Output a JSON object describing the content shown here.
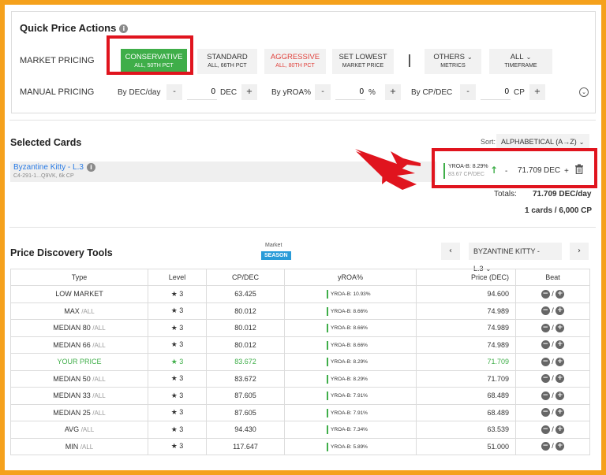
{
  "quick_price": {
    "title": "Quick Price Actions",
    "market_label": "MARKET PRICING",
    "buttons": [
      {
        "label": "CONSERVATIVE",
        "sub": "ALL, 50TH PCT"
      },
      {
        "label": "STANDARD",
        "sub": "ALL, 66TH PCT"
      },
      {
        "label": "AGGRESSIVE",
        "sub": "ALL, 80TH PCT"
      },
      {
        "label": "SET LOWEST",
        "sub": "MARKET PRICE"
      },
      {
        "label": "OTHERS",
        "sub": "METRICS"
      },
      {
        "label": "ALL",
        "sub": "TIMEFRAME"
      }
    ],
    "manual_label": "MANUAL PRICING",
    "manual": [
      {
        "label": "By DEC/day",
        "value": "0",
        "unit": "DEC"
      },
      {
        "label": "By yROA%",
        "value": "0",
        "unit": "%"
      },
      {
        "label": "By CP/DEC",
        "value": "0",
        "unit": "CP"
      }
    ],
    "minus": "-",
    "plus": "+"
  },
  "selected": {
    "title": "Selected Cards",
    "sort_label": "Sort:",
    "sort_value": "ALPHABETICAL (A→Z)",
    "card": {
      "name": "Byzantine Kitty - L.3",
      "sub": "C4-291-1...Q9VK, 6k CP",
      "roa": "YROA-B: 8.29%",
      "cp": "83.67 CP/DEC",
      "price": "71.709",
      "unit": "DEC"
    },
    "totals_label": "Totals:",
    "totals_value": "71.709 DEC/day",
    "count": "1 cards / 6,000 CP"
  },
  "discovery": {
    "title": "Price Discovery Tools",
    "market_caption": "Market",
    "season_badge": "SEASON",
    "card_select": "BYZANTINE KITTY - L.3",
    "prev": "‹",
    "next": "›",
    "headers": [
      "Type",
      "Level",
      "CP/DEC",
      "yROA%",
      "Price (DEC)",
      "Beat"
    ],
    "rows": [
      {
        "type": "LOW MARKET",
        "suffix": "",
        "level": "3",
        "cp": "63.425",
        "roa": "YROA-B: 10.93%",
        "price": "94.600"
      },
      {
        "type": "MAX",
        "suffix": "/ALL",
        "level": "3",
        "cp": "80.012",
        "roa": "YROA-B: 8.66%",
        "price": "74.989"
      },
      {
        "type": "MEDIAN 80",
        "suffix": "/ALL",
        "level": "3",
        "cp": "80.012",
        "roa": "YROA-B: 8.66%",
        "price": "74.989"
      },
      {
        "type": "MEDIAN 66",
        "suffix": "/ALL",
        "level": "3",
        "cp": "80.012",
        "roa": "YROA-B: 8.66%",
        "price": "74.989"
      },
      {
        "type": "YOUR PRICE",
        "suffix": "",
        "level": "3",
        "cp": "83.672",
        "roa": "YROA-B: 8.29%",
        "price": "71.709"
      },
      {
        "type": "MEDIAN 50",
        "suffix": "/ALL",
        "level": "3",
        "cp": "83.672",
        "roa": "YROA-B: 8.29%",
        "price": "71.709"
      },
      {
        "type": "MEDIAN 33",
        "suffix": "/ALL",
        "level": "3",
        "cp": "87.605",
        "roa": "YROA-B: 7.91%",
        "price": "68.489"
      },
      {
        "type": "MEDIAN 25",
        "suffix": "/ALL",
        "level": "3",
        "cp": "87.605",
        "roa": "YROA-B: 7.91%",
        "price": "68.489"
      },
      {
        "type": "AVG",
        "suffix": "/ALL",
        "level": "3",
        "cp": "94.430",
        "roa": "YROA-B: 7.34%",
        "price": "63.539"
      },
      {
        "type": "MIN",
        "suffix": "/ALL",
        "level": "3",
        "cp": "117.647",
        "roa": "YROA-B: 5.89%",
        "price": "51.000"
      }
    ],
    "beat_sep": "/"
  },
  "colors": {
    "accent_green": "#3fae49",
    "aggressive_red": "#e0413c",
    "highlight_red": "#e0141e",
    "link_blue": "#2a7be4",
    "season_blue": "#2a9bd8",
    "frame_orange": "#f5a11c"
  }
}
